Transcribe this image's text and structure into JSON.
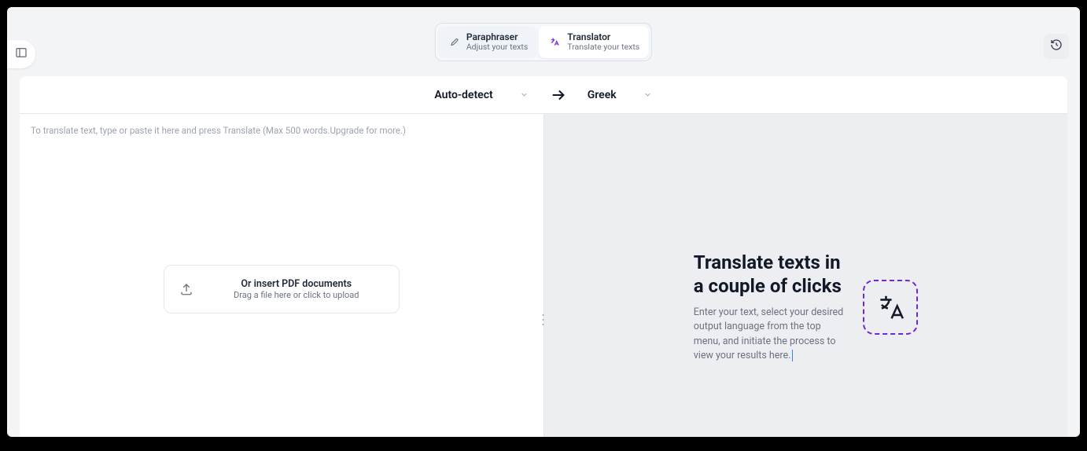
{
  "tabs": {
    "paraphraser": {
      "title": "Paraphraser",
      "sub": "Adjust your texts"
    },
    "translator": {
      "title": "Translator",
      "sub": "Translate your texts"
    }
  },
  "langbar": {
    "source": "Auto-detect",
    "target": "Greek"
  },
  "input": {
    "placeholder": "To translate text, type or paste it here and press Translate (Max 500 words.Upgrade for more.)"
  },
  "upload": {
    "title": "Or insert PDF documents",
    "sub": "Drag a file here or click to upload"
  },
  "empty": {
    "title": "Translate texts in a couple of clicks",
    "desc": "Enter your text, select your desired output language from the top menu, and initiate the process to view your results here."
  }
}
